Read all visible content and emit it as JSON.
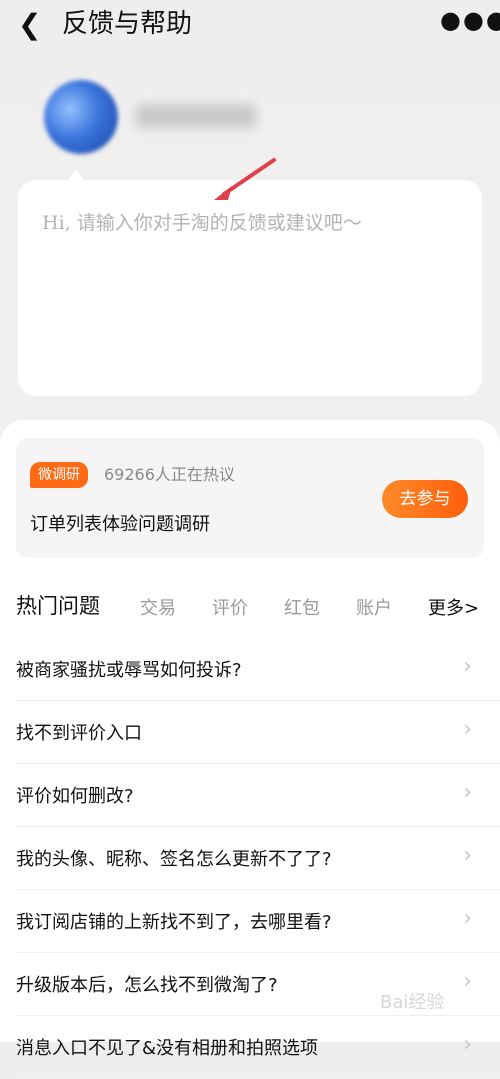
{
  "header": {
    "back_icon": "chevron-left-icon",
    "title": "反馈与帮助",
    "more_icon": "more-dots-icon"
  },
  "feedback": {
    "placeholder": "Hi, 请输入你对手淘的反馈或建议吧～",
    "arrow_color": "#e0404a"
  },
  "survey": {
    "badge": "微调研",
    "count_text": "69266人正在热议",
    "title": "订单列表体验问题调研",
    "join_label": "去参与"
  },
  "tabs": {
    "active": "热门问题",
    "items": [
      "交易",
      "评价",
      "红包",
      "账户"
    ],
    "more": "更多>"
  },
  "questions": [
    "被商家骚扰或辱骂如何投诉?",
    "找不到评价入口",
    "评价如何删改?",
    "我的头像、昵称、签名怎么更新不了了?",
    "我订阅店铺的上新找不到了，去哪里看?",
    "升级版本后，怎么找不到微淘了?",
    "消息入口不见了&没有相册和拍照选项"
  ],
  "watermark": "Bai经验",
  "colors": {
    "accent": "#ff6a13",
    "text": "#111111"
  }
}
